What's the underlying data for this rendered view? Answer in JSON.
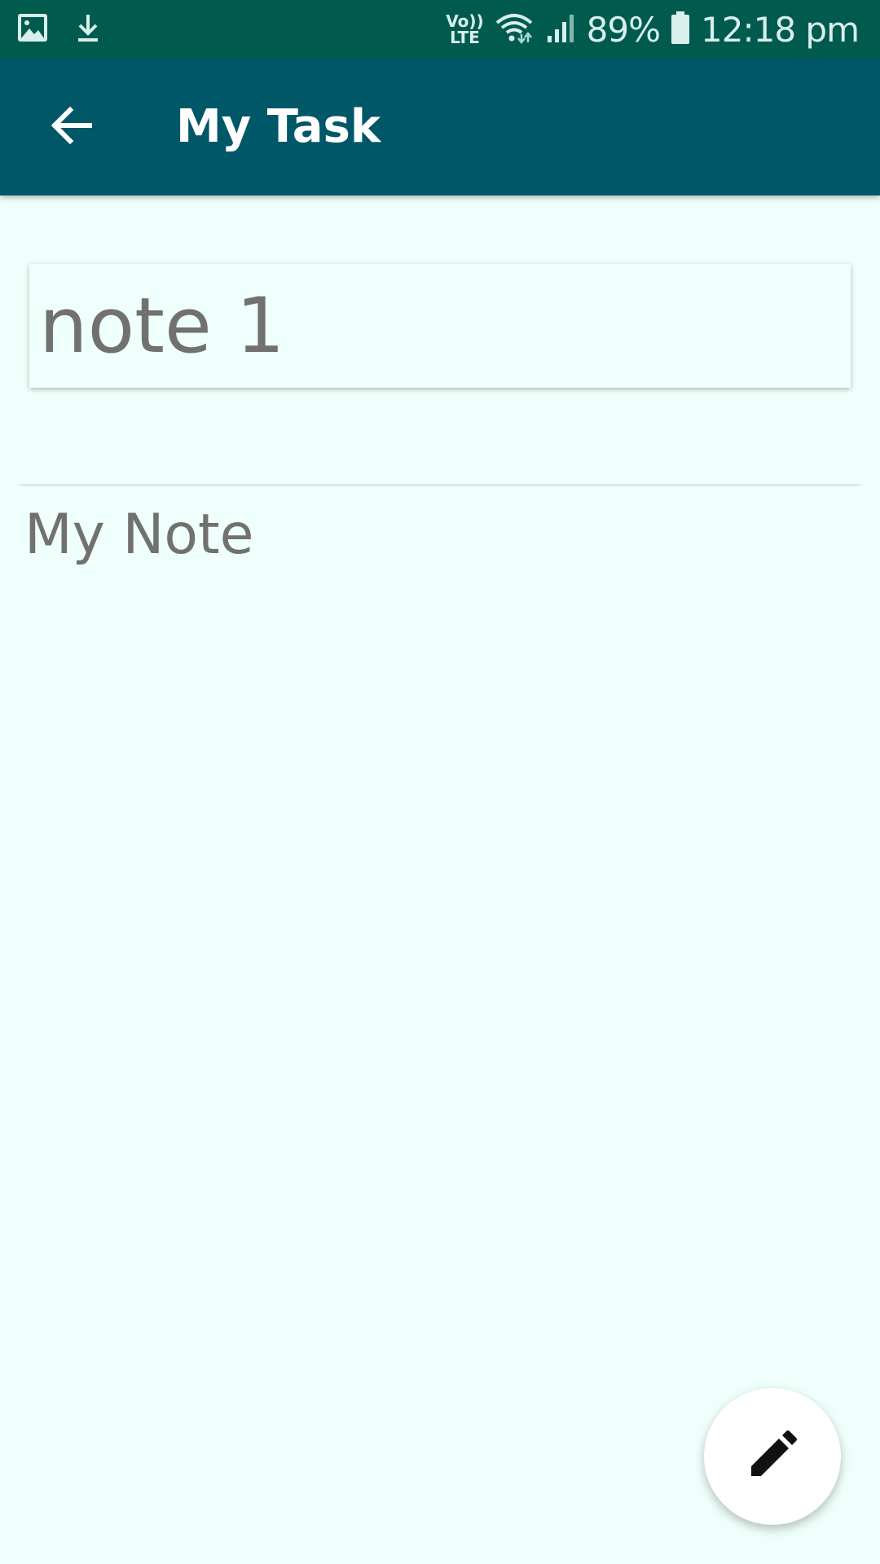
{
  "status_bar": {
    "battery": "89%",
    "time": "12:18 pm",
    "network": "LTE",
    "volte": "Vo))",
    "icons": [
      "image-icon",
      "download-icon",
      "volte-icon",
      "wifi-icon",
      "signal-icon",
      "battery-icon"
    ]
  },
  "app_bar": {
    "title": "My Task",
    "back_icon": "arrow-back-icon",
    "background_color": "#005768"
  },
  "editor": {
    "title_value": "note 1",
    "body_text": "My Note"
  },
  "fab": {
    "icon": "pencil-edit-icon"
  },
  "colors": {
    "status_bar": "#005b4e",
    "background": "#effffb",
    "text": "#717171"
  }
}
